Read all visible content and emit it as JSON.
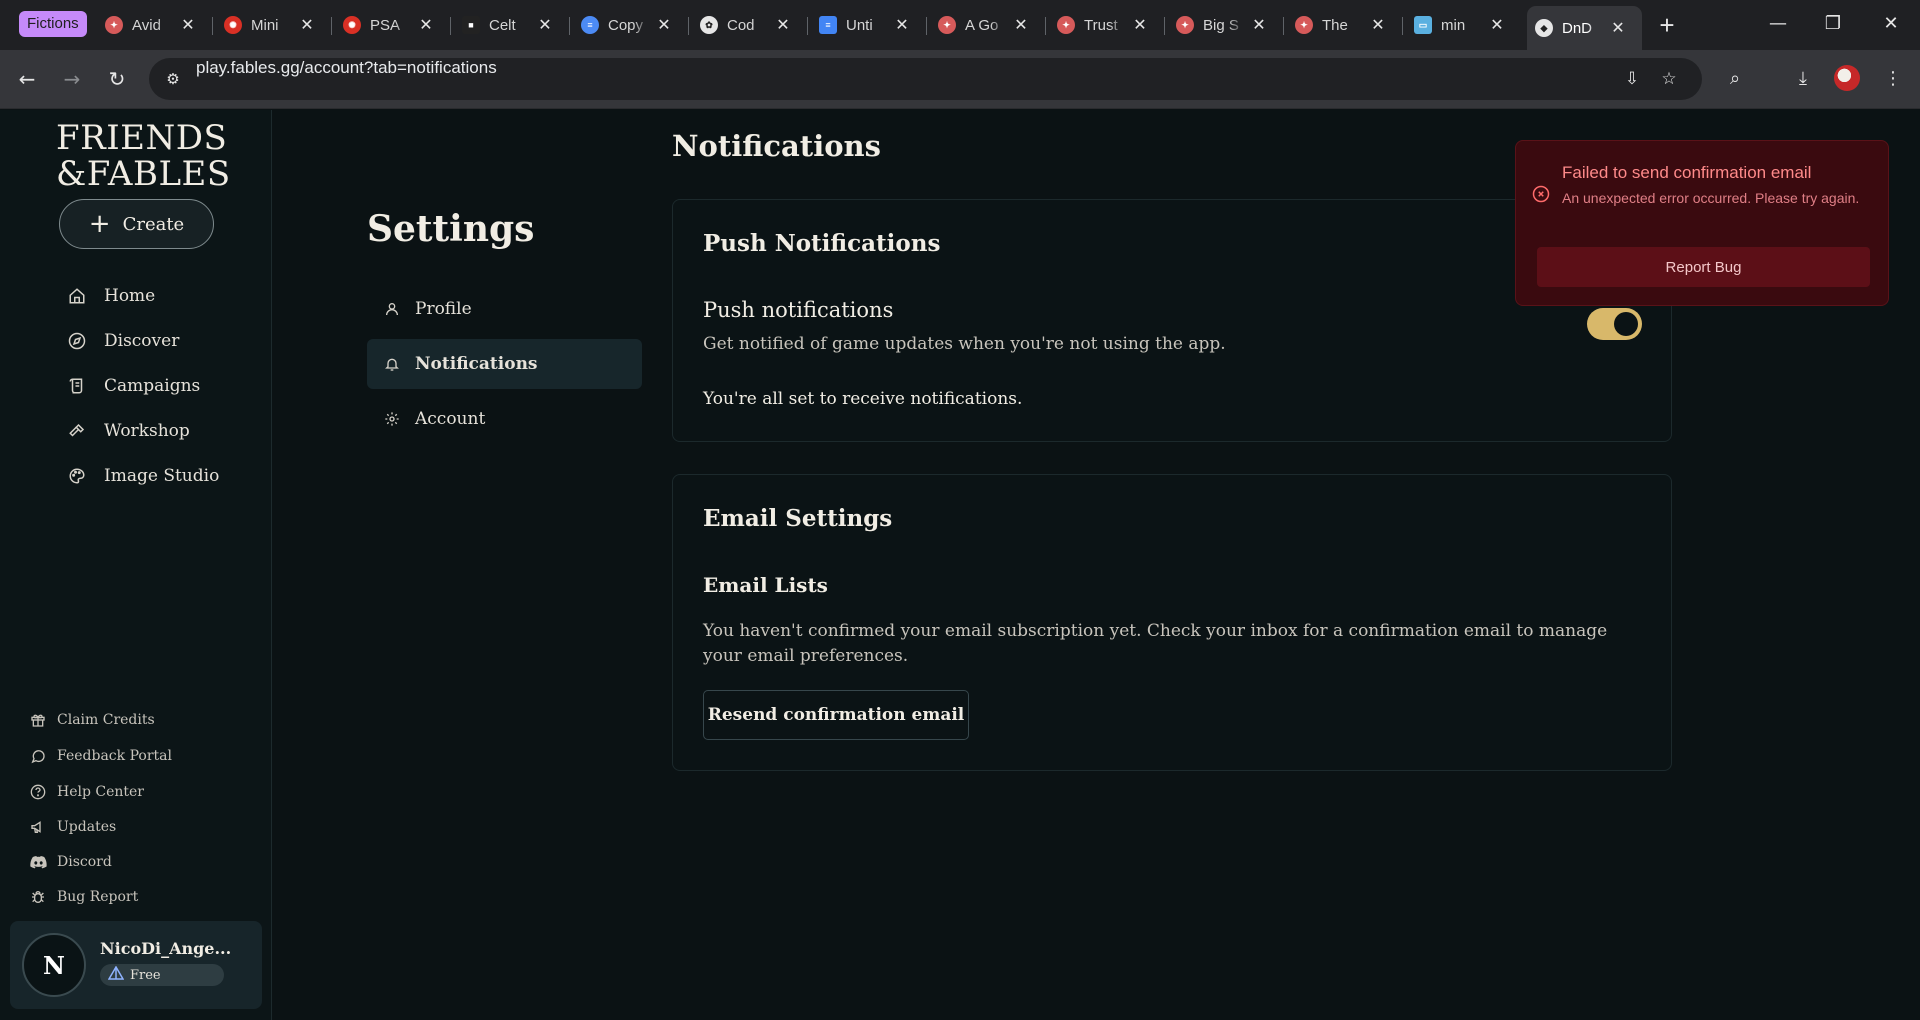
{
  "browser": {
    "tab_group": "Fictions",
    "tabs": [
      {
        "label": "Avid",
        "color": "#d65a5a"
      },
      {
        "label": "Mini",
        "color": "#d93025"
      },
      {
        "label": "PSA",
        "color": "#d93025"
      },
      {
        "label": "Celt",
        "color": "#222222"
      },
      {
        "label": "Copy",
        "color": "#4c8bf5"
      },
      {
        "label": "Cod",
        "color": "#e6e6e6"
      },
      {
        "label": "Unti",
        "color": "#4285f4"
      },
      {
        "label": "A Go",
        "color": "#d65a5a"
      },
      {
        "label": "Trust",
        "color": "#d65a5a"
      },
      {
        "label": "Big S",
        "color": "#d65a5a"
      },
      {
        "label": "The",
        "color": "#d65a5a"
      },
      {
        "label": "min",
        "color": "#5ab0e0"
      },
      {
        "label": "DnD",
        "color": "#e6e6e6"
      }
    ],
    "url": "play.fables.gg/account?tab=notifications"
  },
  "sidebar": {
    "logo_line1": "FRIENDS",
    "logo_line2": "&FABLES",
    "create_label": "Create",
    "nav": [
      {
        "label": "Home",
        "icon": "home-icon"
      },
      {
        "label": "Discover",
        "icon": "compass-icon"
      },
      {
        "label": "Campaigns",
        "icon": "scroll-icon"
      },
      {
        "label": "Workshop",
        "icon": "hammer-icon"
      },
      {
        "label": "Image Studio",
        "icon": "palette-icon"
      }
    ],
    "footer": [
      {
        "label": "Claim Credits",
        "icon": "gift-icon"
      },
      {
        "label": "Feedback Portal",
        "icon": "chat-icon"
      },
      {
        "label": "Help Center",
        "icon": "help-icon"
      },
      {
        "label": "Updates",
        "icon": "megaphone-icon"
      },
      {
        "label": "Discord",
        "icon": "discord-icon"
      },
      {
        "label": "Bug Report",
        "icon": "bug-icon"
      }
    ],
    "user": {
      "initial": "N",
      "name": "NicoDi_Ange...",
      "tier": "Free"
    }
  },
  "settings": {
    "title": "Settings",
    "items": [
      {
        "label": "Profile",
        "icon": "user-icon"
      },
      {
        "label": "Notifications",
        "icon": "bell-icon"
      },
      {
        "label": "Account",
        "icon": "gear-icon"
      }
    ]
  },
  "main": {
    "heading": "Notifications",
    "push": {
      "title": "Push Notifications",
      "row_title": "Push notifications",
      "row_desc": "Get notified of game updates when you're not using the app.",
      "status": "You're all set to receive notifications.",
      "enabled": true
    },
    "email": {
      "title": "Email Settings",
      "lists_title": "Email Lists",
      "desc": "You haven't confirmed your email subscription yet. Check your inbox for a confirmation email to manage your email preferences.",
      "button": "Resend confirmation email"
    }
  },
  "toast": {
    "title": "Failed to send confirmation email",
    "message": "An unexpected error occurred. Please try again.",
    "button": "Report Bug"
  },
  "colors": {
    "accent_toggle": "#d8b86a",
    "toast_bg": "#3a0a0f",
    "toast_title": "#ff8a8a"
  }
}
